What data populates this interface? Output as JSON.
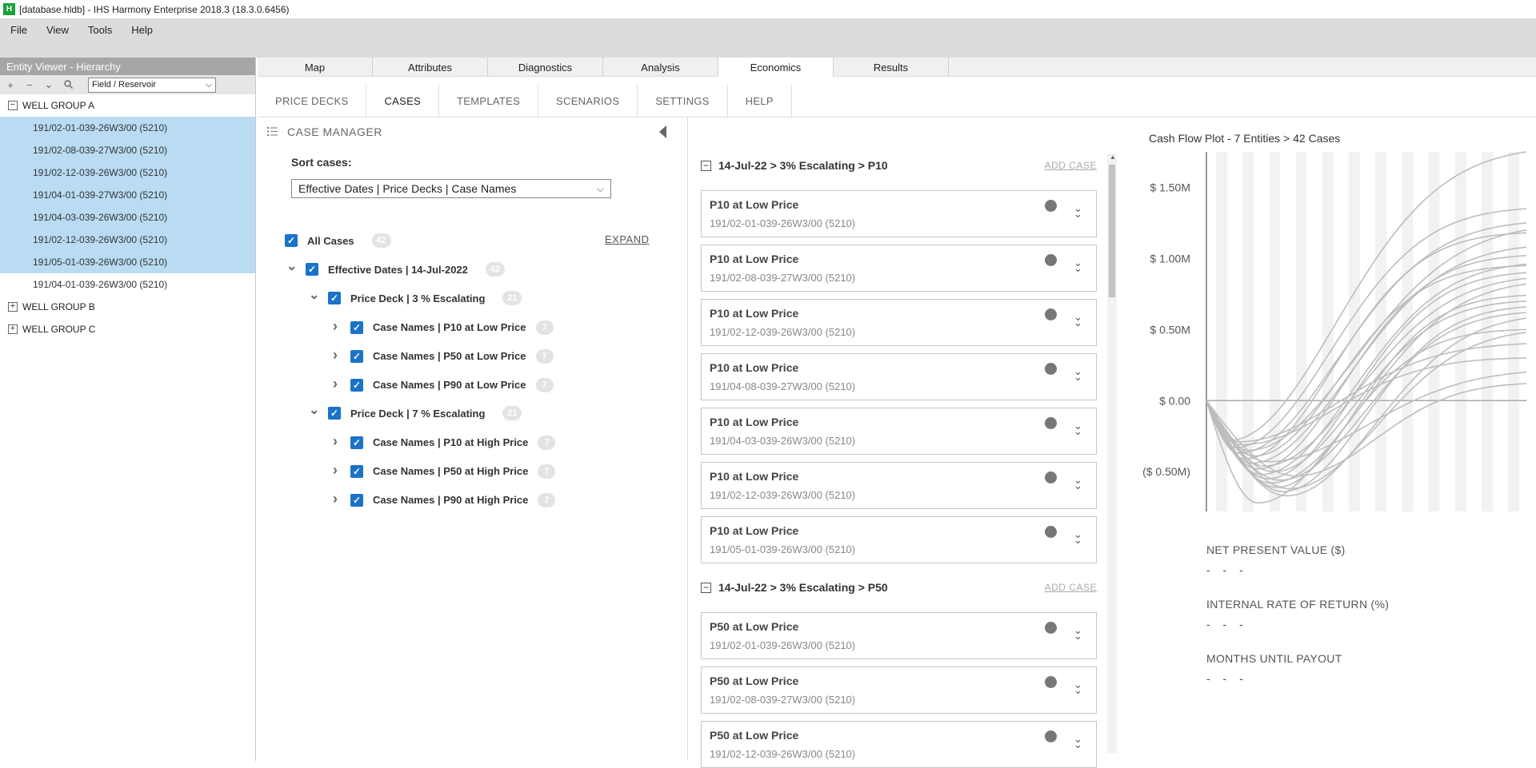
{
  "window": {
    "title": "[database.hldb] - IHS Harmony Enterprise 2018.3 (18.3.0.6456)",
    "app_icon": "H"
  },
  "menu": [
    "File",
    "View",
    "Tools",
    "Help"
  ],
  "entity_viewer": {
    "title": "Entity Viewer - Hierarchy",
    "filter_value": "Field / Reservoir",
    "groups": [
      {
        "label": "WELL GROUP A",
        "expanded": true,
        "items": [
          {
            "label": "191/02-01-039-26W3/00 (5210)",
            "selected": true
          },
          {
            "label": "191/02-08-039-27W3/00 (5210)",
            "selected": true
          },
          {
            "label": "191/02-12-039-26W3/00 (5210)",
            "selected": true
          },
          {
            "label": "191/04-01-039-27W3/00 (5210)",
            "selected": true
          },
          {
            "label": "191/04-03-039-26W3/00 (5210)",
            "selected": true
          },
          {
            "label": "191/02-12-039-26W3/00 (5210)",
            "selected": true
          },
          {
            "label": "191/05-01-039-26W3/00 (5210)",
            "selected": true
          },
          {
            "label": "191/04-01-039-26W3/00 (5210)",
            "selected": false
          }
        ]
      },
      {
        "label": "WELL GROUP B",
        "expanded": false,
        "items": []
      },
      {
        "label": "WELL GROUP C",
        "expanded": false,
        "items": []
      }
    ]
  },
  "main_tabs": [
    "Map",
    "Attributes",
    "Diagnostics",
    "Analysis",
    "Economics",
    "Results"
  ],
  "active_main_tab": "Economics",
  "sub_tabs": [
    "PRICE DECKS",
    "CASES",
    "TEMPLATES",
    "SCENARIOS",
    "SETTINGS",
    "HELP"
  ],
  "active_sub_tab": "CASES",
  "case_manager": {
    "title": "CASE MANAGER",
    "sort_label": "Sort cases:",
    "sort_value": "Effective Dates | Price Decks | Case Names",
    "expand_label": "EXPAND",
    "all_cases": {
      "label": "All Cases",
      "count": "42"
    },
    "effective_date": {
      "label": "Effective Dates  |  14-Jul-2022",
      "count": "42"
    },
    "price_decks": [
      {
        "label": "Price Deck  |  3 % Escalating",
        "count": "21",
        "cases": [
          {
            "label": "Case Names  |  P10 at Low Price",
            "count": "7"
          },
          {
            "label": "Case Names  |  P50 at Low Price",
            "count": "7"
          },
          {
            "label": "Case Names  |  P90 at Low Price",
            "count": "7"
          }
        ]
      },
      {
        "label": "Price Deck  |  7 % Escalating",
        "count": "21",
        "cases": [
          {
            "label": "Case Names  |  P10 at High Price",
            "count": "7"
          },
          {
            "label": "Case Names  |  P50 at High Price",
            "count": "7"
          },
          {
            "label": "Case Names  |  P90 at High Price",
            "count": "7"
          }
        ]
      }
    ]
  },
  "case_groups": [
    {
      "header": "14-Jul-22 > 3% Escalating > P10",
      "add_label": "ADD CASE",
      "cases": [
        {
          "name": "P10 at Low Price",
          "well": "191/02-01-039-26W3/00 (5210)"
        },
        {
          "name": "P10 at Low Price",
          "well": "191/02-08-039-27W3/00 (5210)"
        },
        {
          "name": "P10 at Low Price",
          "well": "191/02-12-039-26W3/00 (5210)"
        },
        {
          "name": "P10 at Low Price",
          "well": "191/04-08-039-27W3/00 (5210)"
        },
        {
          "name": "P10 at Low Price",
          "well": "191/04-03-039-26W3/00 (5210)"
        },
        {
          "name": "P10 at Low Price",
          "well": "191/02-12-039-26W3/00 (5210)"
        },
        {
          "name": "P10 at Low Price",
          "well": "191/05-01-039-26W3/00 (5210)"
        }
      ]
    },
    {
      "header": "14-Jul-22 > 3% Escalating > P50",
      "add_label": "ADD CASE",
      "cases": [
        {
          "name": "P50 at Low Price",
          "well": "191/02-01-039-26W3/00 (5210)"
        },
        {
          "name": "P50 at Low Price",
          "well": "191/02-08-039-27W3/00 (5210)"
        },
        {
          "name": "P50 at Low Price",
          "well": "191/02-12-039-26W3/00 (5210)"
        }
      ]
    }
  ],
  "chart_data": {
    "type": "line",
    "title": "Cash Flow Plot - 7 Entities  >  42 Cases",
    "y_ticks": [
      "$ 1.50M",
      "$ 1.00M",
      "$ 0.50M",
      "$ 0.00",
      "($ 0.50M)"
    ],
    "y_tick_values": [
      1.5,
      1.0,
      0.5,
      0.0,
      -0.5
    ],
    "ylim": [
      -0.78,
      1.75
    ],
    "xlim": [
      0,
      1
    ],
    "series_minimums": [
      -0.28,
      -0.33,
      -0.37,
      -0.41,
      -0.44,
      -0.48,
      -0.52,
      -0.55,
      -0.58,
      -0.61,
      -0.64,
      -0.67,
      -0.72,
      -0.29,
      -0.35,
      -0.39,
      -0.46,
      -0.5,
      -0.56,
      -0.62,
      -0.31,
      -0.43,
      -0.53
    ],
    "series_minimum_positions": [
      0.07,
      0.09,
      0.1,
      0.12,
      0.14,
      0.16,
      0.17,
      0.19,
      0.2,
      0.22,
      0.24,
      0.25,
      0.16,
      0.1,
      0.13,
      0.15,
      0.18,
      0.21,
      0.23,
      0.26,
      0.11,
      0.19,
      0.28
    ],
    "series_end_values": [
      1.75,
      1.35,
      1.25,
      1.18,
      1.08,
      1.02,
      0.96,
      0.9,
      0.82,
      0.74,
      0.66,
      0.58,
      0.5,
      0.4,
      1.2,
      0.95,
      0.86,
      0.7,
      0.62,
      0.48,
      0.3,
      0.2,
      0.12
    ],
    "series_ramp_rates": [
      2.8,
      3.4,
      3.1,
      3.7,
      2.9,
      3.5,
      3.0,
      3.3,
      2.7,
      3.6,
      3.2,
      2.6,
      3.9,
      3.0,
      2.5,
      3.8,
      2.8,
      3.4,
      3.1,
      2.6,
      3.5,
      2.4,
      3.0
    ]
  },
  "metrics": [
    {
      "label": "NET PRESENT VALUE ($)",
      "value": "- - -"
    },
    {
      "label": "INTERNAL RATE OF RETURN (%)",
      "value": "- - -"
    },
    {
      "label": "MONTHS UNTIL PAYOUT",
      "value": "- - -"
    }
  ]
}
